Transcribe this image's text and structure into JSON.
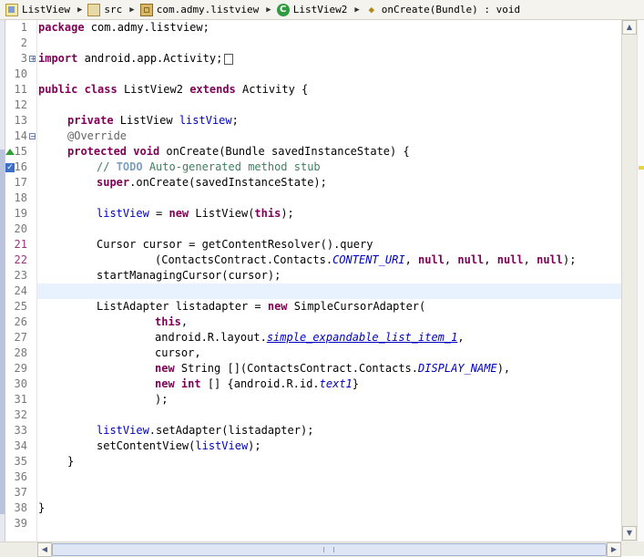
{
  "breadcrumb": [
    {
      "label": "ListView",
      "icon": "project-icon"
    },
    {
      "label": "src",
      "icon": "source-folder-icon"
    },
    {
      "label": "com.admy.listview",
      "icon": "package-icon"
    },
    {
      "label": "ListView2",
      "icon": "class-icon"
    },
    {
      "label": "onCreate(Bundle) : void",
      "icon": "method-icon"
    }
  ],
  "editor": {
    "current_line": 24,
    "line_numbers": [
      "1",
      "2",
      "3",
      "10",
      "11",
      "12",
      "13",
      "14",
      "15",
      "16",
      "17",
      "18",
      "19",
      "20",
      "21",
      "22",
      "23",
      "24",
      "25",
      "26",
      "27",
      "28",
      "29",
      "30",
      "31",
      "32",
      "33",
      "34",
      "35",
      "36",
      "37",
      "38",
      "39"
    ],
    "code": {
      "l1_kw": "package",
      "l1_rest": " com.admy.listview;",
      "l3_kw": "import",
      "l3_rest": " android.app.Activity;",
      "l11_kw1": "public",
      "l11_kw2": "class",
      "l11_mid": " ListView2 ",
      "l11_kw3": "extends",
      "l11_rest": " Activity {",
      "l13_kw": "private",
      "l13_mid": " ListView ",
      "l13_fld": "listView",
      "l13_end": ";",
      "l14_ann": "@Override",
      "l15_kw1": "protected",
      "l15_kw2": "void",
      "l15_rest": " onCreate(Bundle savedInstanceState) {",
      "l16_cm1": "// ",
      "l16_todo": "TODO",
      "l16_cm2": " Auto-generated method stub",
      "l17_kw": "super",
      "l17_rest": ".onCreate(savedInstanceState);",
      "l19_fld": "listView",
      "l19_mid": " = ",
      "l19_kw1": "new",
      "l19_mid2": " ListView(",
      "l19_kw2": "this",
      "l19_end": ");",
      "l21_text": "Cursor cursor = getContentResolver().query",
      "l22_a": "(ContactsContract.Contacts.",
      "l22_sf": "CONTENT_URI",
      "l22_sep": ", ",
      "l22_null": "null",
      "l22_end": ");",
      "l23_text": "startManagingCursor(cursor);",
      "l25_a": "ListAdapter listadapter = ",
      "l25_kw": "new",
      "l25_rest": " SimpleCursorAdapter(",
      "l26_kw": "this",
      "l26_end": ",",
      "l27_a": "android.R.layout.",
      "l27_sf": "simple_expandable_list_item_1",
      "l27_end": ",",
      "l28_text": "cursor,",
      "l29_kw": "new",
      "l29_a": " String [](ContactsContract.Contacts.",
      "l29_sf": "DISPLAY_NAME",
      "l29_end": "),",
      "l30_kw1": "new",
      "l30_kw2": "int",
      "l30_a": " [] {android.R.id.",
      "l30_sf": "text1",
      "l30_end": "}",
      "l31_text": ");",
      "l33_fld": "listView",
      "l33_rest": ".setAdapter(listadapter);",
      "l34_a": "setContentView(",
      "l34_fld": "listView",
      "l34_end": ");",
      "l35_text": "}",
      "l38_text": "}"
    }
  }
}
